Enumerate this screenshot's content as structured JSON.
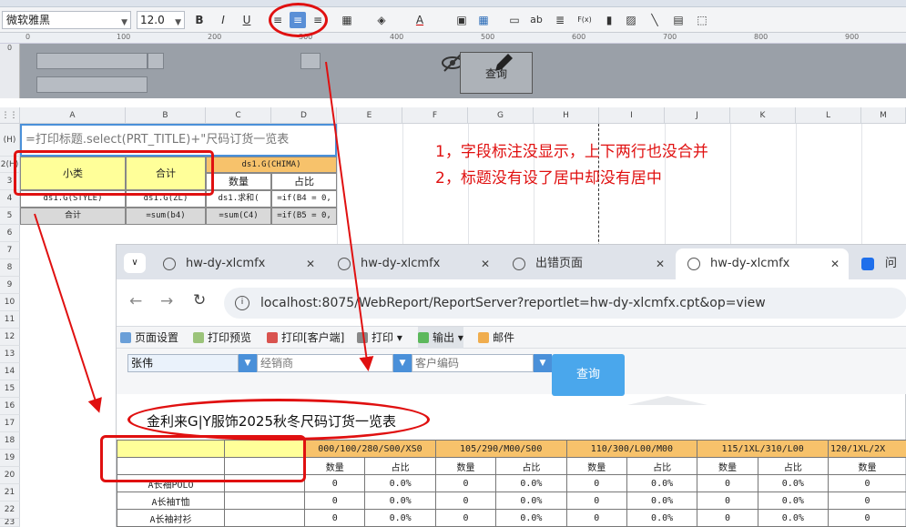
{
  "toolbar": {
    "font": "微软雅黑",
    "size": "12.0",
    "bold": "B",
    "italic": "I",
    "underline": "U",
    "text_style": "ab",
    "formula": "F(x)"
  },
  "ruler": [
    "0",
    "100",
    "200",
    "300",
    "400",
    "500",
    "600",
    "700",
    "800",
    "900"
  ],
  "vruler": "0",
  "param_panel": {
    "query_label": "查询"
  },
  "sheet": {
    "columns": [
      "A",
      "B",
      "C",
      "D",
      "E",
      "F",
      "G",
      "H",
      "I",
      "J",
      "K",
      "L",
      "M"
    ],
    "rows": [
      "(H)",
      "2(H)",
      "3",
      "4",
      "5",
      "6",
      "7",
      "8",
      "9",
      "10",
      "11",
      "12",
      "13",
      "14",
      "15",
      "16",
      "17",
      "18",
      "19",
      "20",
      "21",
      "22",
      "23"
    ],
    "title_formula": "=打印标题.select(PRT_TITLE)+\"尺码订货一览表",
    "r2_a": "小类",
    "r2_b": "合计",
    "r2_c": "ds1.G(CHIMA)",
    "r3_c": "数量",
    "r3_d": "占比",
    "r4_a": "ds1.G(STYLE)",
    "r4_b": "ds1.G(ZL)",
    "r4_c": "ds1.求和(",
    "r4_d": "=if(B4 = 0,",
    "r5_a": "合计",
    "r5_b": "=sum(b4)",
    "r5_c": "=sum(C4)",
    "r5_d": "=if(B5 = 0,"
  },
  "annotation": {
    "line1": "1，字段标注没显示，上下两行也没合并",
    "line2": "2，标题没有设了居中却没有居中"
  },
  "browser": {
    "tabs": [
      {
        "label": "hw-dy-xlcmfx",
        "active": false
      },
      {
        "label": "hw-dy-xlcmfx",
        "active": false
      },
      {
        "label": "出错页面",
        "active": false
      },
      {
        "label": "hw-dy-xlcmfx",
        "active": true
      },
      {
        "label": "问答 -",
        "active": false
      }
    ],
    "url": "localhost:8075/WebReport/ReportServer?reportlet=hw-dy-xlcmfx.cpt&op=view",
    "toolbar": [
      "页面设置",
      "打印预览",
      "打印[客户端]",
      "打印",
      "输出",
      "邮件"
    ],
    "params": {
      "salesperson": "张伟",
      "dealer_placeholder": "经销商",
      "customer_placeholder": "客户编码",
      "query_button": "查询"
    },
    "report": {
      "title": "金利来G|Y服饰2025秋冬尺码订货一览表",
      "size_headers": [
        "000/100/280/S00/XS0",
        "105/290/M00/S00",
        "110/300/L00/M00",
        "115/1XL/310/L00",
        "120/1XL/2X"
      ],
      "sub_headers": [
        "数量",
        "占比",
        "数量",
        "占比",
        "数量",
        "占比",
        "数量",
        "占比",
        "数量"
      ],
      "rows": [
        {
          "name": "A长袖POLO",
          "values": [
            "0",
            "0.0%",
            "0",
            "0.0%",
            "0",
            "0.0%",
            "0",
            "0.0%",
            "0"
          ]
        },
        {
          "name": "A长袖T恤",
          "values": [
            "0",
            "0.0%",
            "0",
            "0.0%",
            "0",
            "0.0%",
            "0",
            "0.0%",
            "0"
          ]
        },
        {
          "name": "A长袖衬衫",
          "values": [
            "0",
            "0.0%",
            "0",
            "0.0%",
            "0",
            "0.0%",
            "0",
            "0.0%",
            "0"
          ]
        }
      ]
    }
  },
  "colors": {
    "annotation_red": "#e01010",
    "header_yellow": "#ffff99",
    "size_header_orange": "#f7c26b",
    "highlight_blue": "#4a90d9"
  }
}
